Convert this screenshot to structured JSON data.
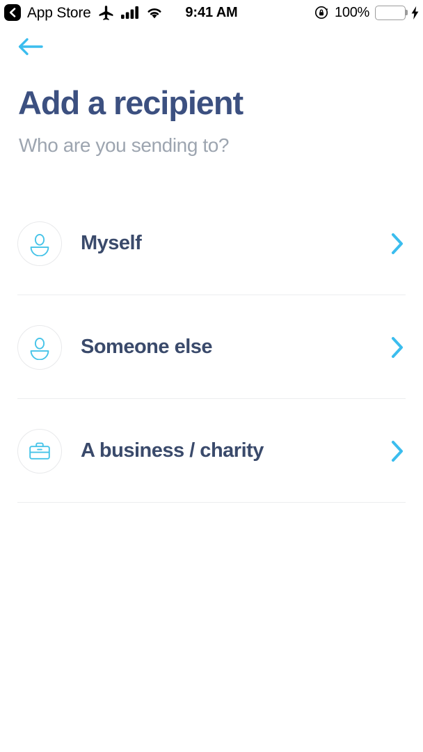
{
  "status_bar": {
    "back_chip_icon": "chevron-left-icon",
    "app_name": "App Store",
    "airplane_icon": "airplane-mode-icon",
    "signal_icon": "cellular-signal-icon",
    "wifi_icon": "wifi-icon",
    "time": "9:41 AM",
    "rotation_lock_icon": "rotation-lock-icon",
    "battery_percent": "100%",
    "battery_icon": "battery-full-icon",
    "charging_icon": "charging-bolt-icon",
    "battery_color": "#4CD764"
  },
  "nav": {
    "back_icon": "arrow-left-icon",
    "accent_color": "#3BBDEE"
  },
  "header": {
    "title": "Add a recipient",
    "subtitle": "Who are you sending to?",
    "title_color": "#3C5080",
    "subtitle_color": "#9DA5B0"
  },
  "options": [
    {
      "label": "Myself",
      "icon": "person-icon",
      "chevron": "chevron-right-icon"
    },
    {
      "label": "Someone else",
      "icon": "person-icon",
      "chevron": "chevron-right-icon"
    },
    {
      "label": "A business / charity",
      "icon": "briefcase-icon",
      "chevron": "chevron-right-icon"
    }
  ]
}
